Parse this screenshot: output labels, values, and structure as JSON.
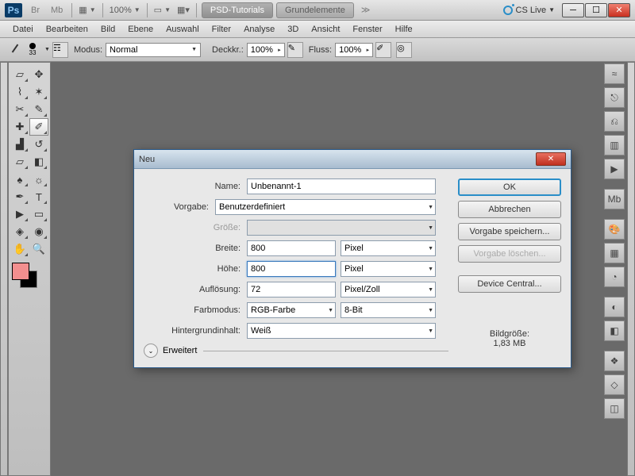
{
  "topbar": {
    "app": "Ps",
    "boxes": [
      "Br",
      "Mb"
    ],
    "zoom": "100%",
    "tabs": [
      {
        "label": "PSD-Tutorials",
        "active": true
      },
      {
        "label": "Grundelemente",
        "active": false
      }
    ],
    "chevrons": "≫",
    "cslive": "CS Live"
  },
  "menu": [
    "Datei",
    "Bearbeiten",
    "Bild",
    "Ebene",
    "Auswahl",
    "Filter",
    "Analyse",
    "3D",
    "Ansicht",
    "Fenster",
    "Hilfe"
  ],
  "options": {
    "brush_num": "33",
    "mode_lbl": "Modus:",
    "mode_val": "Normal",
    "opacity_lbl": "Deckkr.:",
    "opacity_val": "100%",
    "flow_lbl": "Fluss:",
    "flow_val": "100%"
  },
  "dialog": {
    "title": "Neu",
    "labels": {
      "name": "Name:",
      "preset": "Vorgabe:",
      "size": "Größe:",
      "width": "Breite:",
      "height": "Höhe:",
      "resolution": "Auflösung:",
      "colormode": "Farbmodus:",
      "bgcontent": "Hintergrundinhalt:",
      "advanced": "Erweitert"
    },
    "values": {
      "name": "Unbenannt-1",
      "preset": "Benutzerdefiniert",
      "width": "800",
      "width_unit": "Pixel",
      "height": "800",
      "height_unit": "Pixel",
      "resolution": "72",
      "resolution_unit": "Pixel/Zoll",
      "colormode": "RGB-Farbe",
      "bitdepth": "8-Bit",
      "bgcontent": "Weiß"
    },
    "buttons": {
      "ok": "OK",
      "cancel": "Abbrechen",
      "save_preset": "Vorgabe speichern...",
      "delete_preset": "Vorgabe löschen...",
      "device_central": "Device Central..."
    },
    "imagesize_lbl": "Bildgröße:",
    "imagesize_val": "1,83 MB"
  }
}
